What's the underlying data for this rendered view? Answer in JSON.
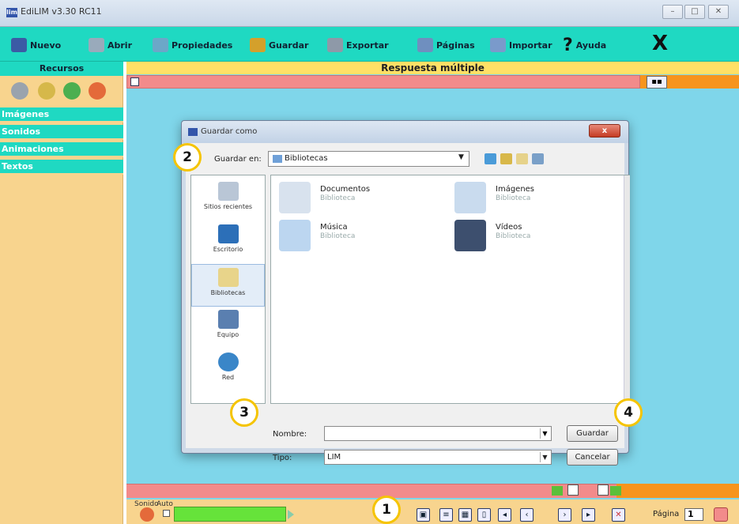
{
  "window": {
    "title": "EdiLIM  v3.30 RC11",
    "buttons": [
      "–",
      "□",
      "✕"
    ]
  },
  "toolbar": {
    "items": [
      {
        "label": "Nuevo",
        "icon": "new-icon",
        "color": "#3b5ba5"
      },
      {
        "label": "Abrir",
        "icon": "open-icon",
        "color": "#9ab"
      },
      {
        "label": "Propiedades",
        "icon": "properties-icon",
        "color": "#6ca7c8"
      },
      {
        "label": "Guardar",
        "icon": "save-icon",
        "color": "#d4a02b"
      },
      {
        "label": "Exportar",
        "icon": "export-icon",
        "color": "#8e99a8"
      },
      {
        "label": "Páginas",
        "icon": "pages-icon",
        "color": "#6f8fbf"
      },
      {
        "label": "Importar",
        "icon": "import-icon",
        "color": "#7a9acb"
      },
      {
        "label": "Ayuda",
        "icon": "help-icon",
        "color": "#1a1a1a"
      }
    ],
    "close": "X"
  },
  "left_panel": {
    "header": "Recursos",
    "items": [
      "Imágenes",
      "Sonidos",
      "Animaciones",
      "Textos"
    ]
  },
  "main": {
    "title": "Respuesta múltiple"
  },
  "dialog": {
    "title": "Guardar como",
    "save_in_label": "Guardar en:",
    "save_in_value": "Bibliotecas",
    "places": [
      "Sitios recientes",
      "Escritorio",
      "Bibliotecas",
      "Equipo",
      "Red"
    ],
    "selected_place": "Bibliotecas",
    "files": [
      {
        "name": "Documentos",
        "sub": "Biblioteca"
      },
      {
        "name": "Imágenes",
        "sub": "Biblioteca"
      },
      {
        "name": "Música",
        "sub": "Biblioteca"
      },
      {
        "name": "Vídeos",
        "sub": "Biblioteca"
      }
    ],
    "name_label": "Nombre:",
    "name_value": "",
    "type_label": "Tipo:",
    "type_value": "LIM",
    "save_button": "Guardar",
    "cancel_button": "Cancelar",
    "close_button": "x"
  },
  "bottom": {
    "sonido_label": "Sonido",
    "auto_label": "Auto",
    "pagina_label": "Página",
    "pagina_value": "1"
  },
  "callouts": [
    "1",
    "2",
    "3",
    "4"
  ],
  "colors": {
    "teal": "#1fd9c2",
    "sand": "#f8d48e",
    "sky": "#7fd6ea",
    "salmon": "#f28b8b",
    "orange": "#f7941d",
    "callout_ring": "#f5c400"
  }
}
